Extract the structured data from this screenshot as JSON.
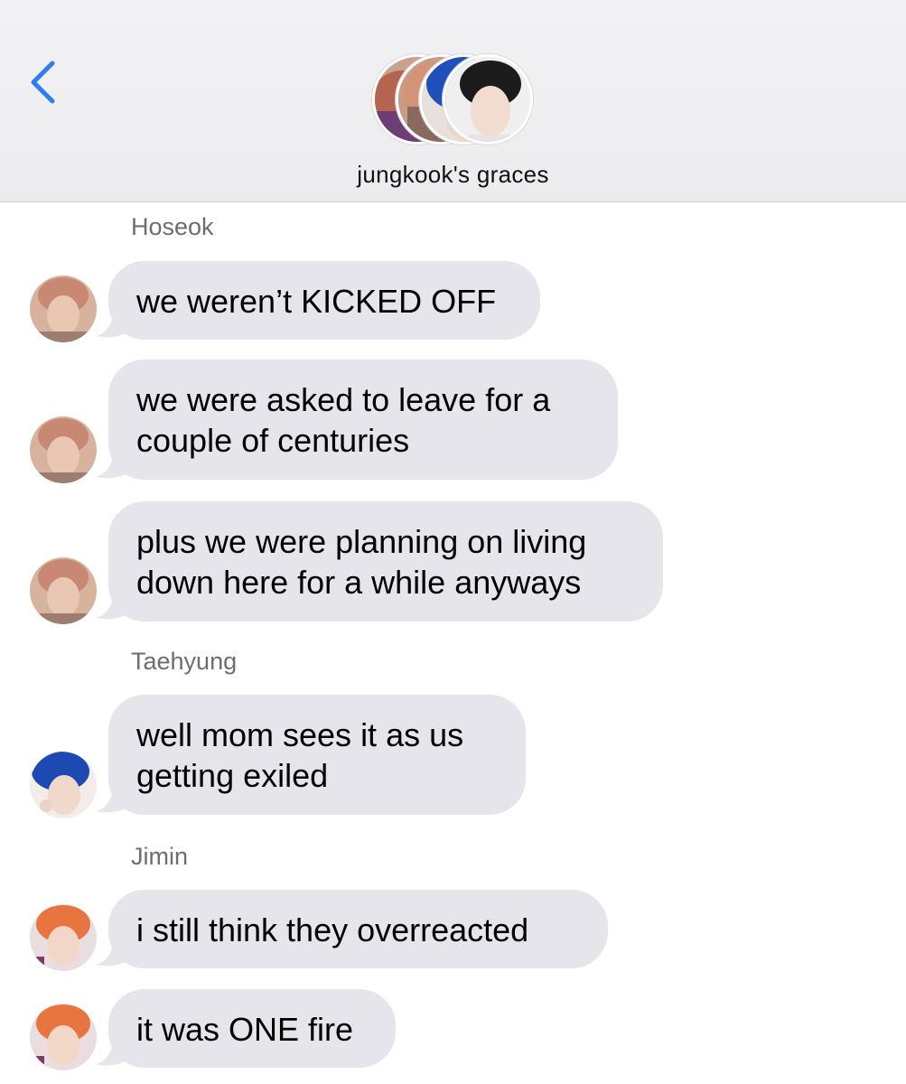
{
  "header": {
    "back_icon": "chevron-left-icon",
    "group_name": "jungkook's graces",
    "accent_color": "#2f7cf6"
  },
  "messages": [
    {
      "sender": "Hoseok",
      "text": "we weren’t KICKED OFF"
    },
    {
      "sender": "Hoseok",
      "text": "we were asked to leave for a couple of centuries"
    },
    {
      "sender": "Hoseok",
      "text": "plus we were planning on living down here for a while anyways"
    },
    {
      "sender": "Taehyung",
      "text": "well mom sees it as us getting exiled"
    },
    {
      "sender": "Jimin",
      "text": "i still think they overreacted"
    },
    {
      "sender": "Jimin",
      "text": "it was ONE fire"
    }
  ],
  "colors": {
    "bubble_incoming": "#e6e5eb",
    "header_bg": "#f2f2f4",
    "sender_label": "#6d6d72"
  }
}
